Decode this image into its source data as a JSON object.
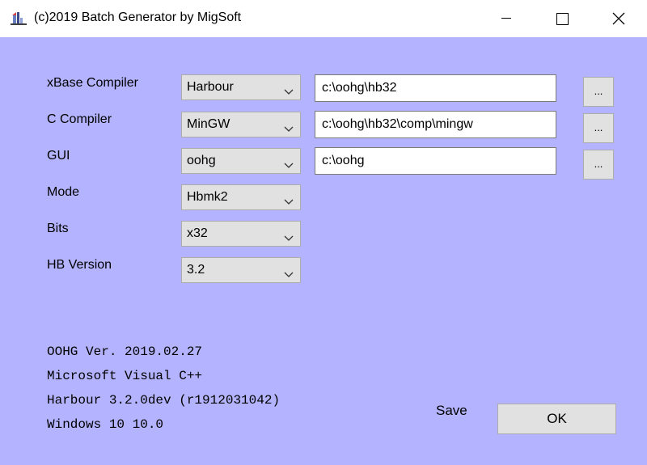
{
  "window": {
    "title": "(c)2019 Batch Generator by MigSoft",
    "icon": "batch-generator-app-icon",
    "controls": [
      "minimize-icon",
      "maximize-icon",
      "close-icon"
    ],
    "background_color": "#b3b3ff"
  },
  "form": {
    "rows": [
      {
        "label": "xBase Compiler",
        "selected": "Harbour",
        "path": "c:\\oohg\\hb32",
        "browse_label": "..."
      },
      {
        "label": "C Compiler",
        "selected": "MinGW",
        "path": "c:\\oohg\\hb32\\comp\\mingw",
        "browse_label": "..."
      },
      {
        "label": "GUI",
        "selected": "oohg",
        "path": "c:\\oohg",
        "browse_label": "..."
      },
      {
        "label": "Mode",
        "selected": "Hbmk2"
      },
      {
        "label": "Bits",
        "selected": "x32"
      },
      {
        "label": "HB Version",
        "selected": "3.2"
      }
    ]
  },
  "info": {
    "lines": [
      "OOHG Ver. 2019.02.27",
      "Microsoft Visual C++",
      "Harbour 3.2.0dev (r1912031042)",
      "Windows 10 10.0"
    ]
  },
  "footer": {
    "save_label": "Save",
    "ok_label": "OK"
  }
}
